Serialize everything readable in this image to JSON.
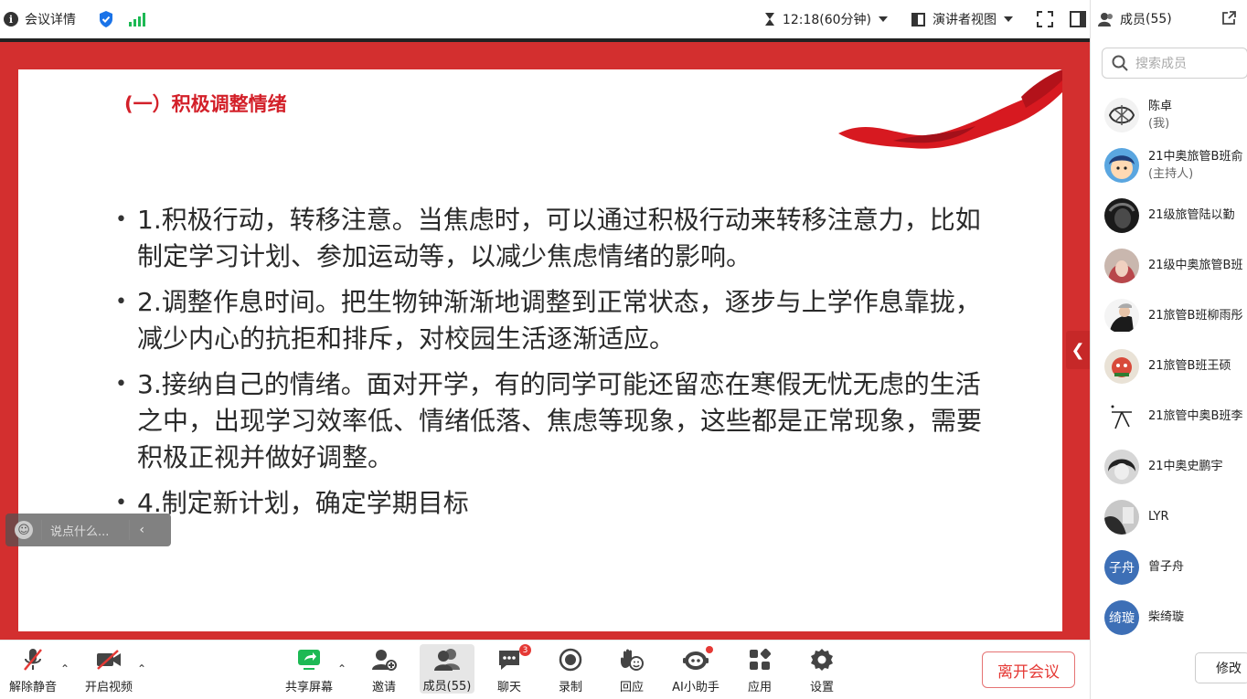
{
  "topbar": {
    "meeting_info": "会议详情",
    "timer": "12:18(60分钟)",
    "view_mode": "演讲者视图"
  },
  "slide": {
    "title": "(一）积极调整情绪",
    "bullets": [
      "1.积极行动，转移注意。当焦虑时，可以通过积极行动来转移注意力，比如制定学习计划、参加运动等，以减少焦虑情绪的影响。",
      "2.调整作息时间。把生物钟渐渐地调整到正常状态，逐步与上学作息靠拢，减少内心的抗拒和排斥，对校园生活逐渐适应。",
      "3.接纳自己的情绪。面对开学，有的同学可能还留恋在寒假无忧无虑的生活之中，出现学习效率低、情绪低落、焦虑等现象，这些都是正常现象，需要积极正视并做好调整。",
      "4.制定新计划，确定学期目标"
    ]
  },
  "chat_input": {
    "placeholder": "说点什么..."
  },
  "toolbar": {
    "unmute": "解除静音",
    "start_video": "开启视频",
    "share_screen": "共享屏幕",
    "invite": "邀请",
    "members": "成员(55)",
    "chat": "聊天",
    "chat_badge": "3",
    "record": "录制",
    "reaction": "回应",
    "ai_assistant": "AI小助手",
    "apps": "应用",
    "settings": "设置",
    "leave": "离开会议"
  },
  "panel": {
    "title": "成员",
    "count": "(55)",
    "search_placeholder": "搜索成员",
    "members": [
      {
        "name": "陈卓",
        "role": "(我)"
      },
      {
        "name": "21中奥旅管B班俞",
        "role": "(主持人)"
      },
      {
        "name": "21级旅管陆以勤",
        "role": ""
      },
      {
        "name": "21级中奥旅管B班",
        "role": ""
      },
      {
        "name": "21旅管B班柳雨彤",
        "role": ""
      },
      {
        "name": "21旅管B班王硕",
        "role": ""
      },
      {
        "name": "21旅管中奥B班李",
        "role": ""
      },
      {
        "name": "21中奥史鹏宇",
        "role": ""
      },
      {
        "name": "LYR",
        "role": ""
      },
      {
        "name": "曾子舟",
        "role": "",
        "initials": "子舟"
      },
      {
        "name": "柴绮璇",
        "role": "",
        "initials": "绮璇"
      }
    ],
    "modify_button": "修改"
  },
  "colors": {
    "stage_red": "#d32f2f",
    "title_red": "#d32029",
    "leave_red": "#e53935",
    "avatar_blue": "#3d6fb6"
  }
}
